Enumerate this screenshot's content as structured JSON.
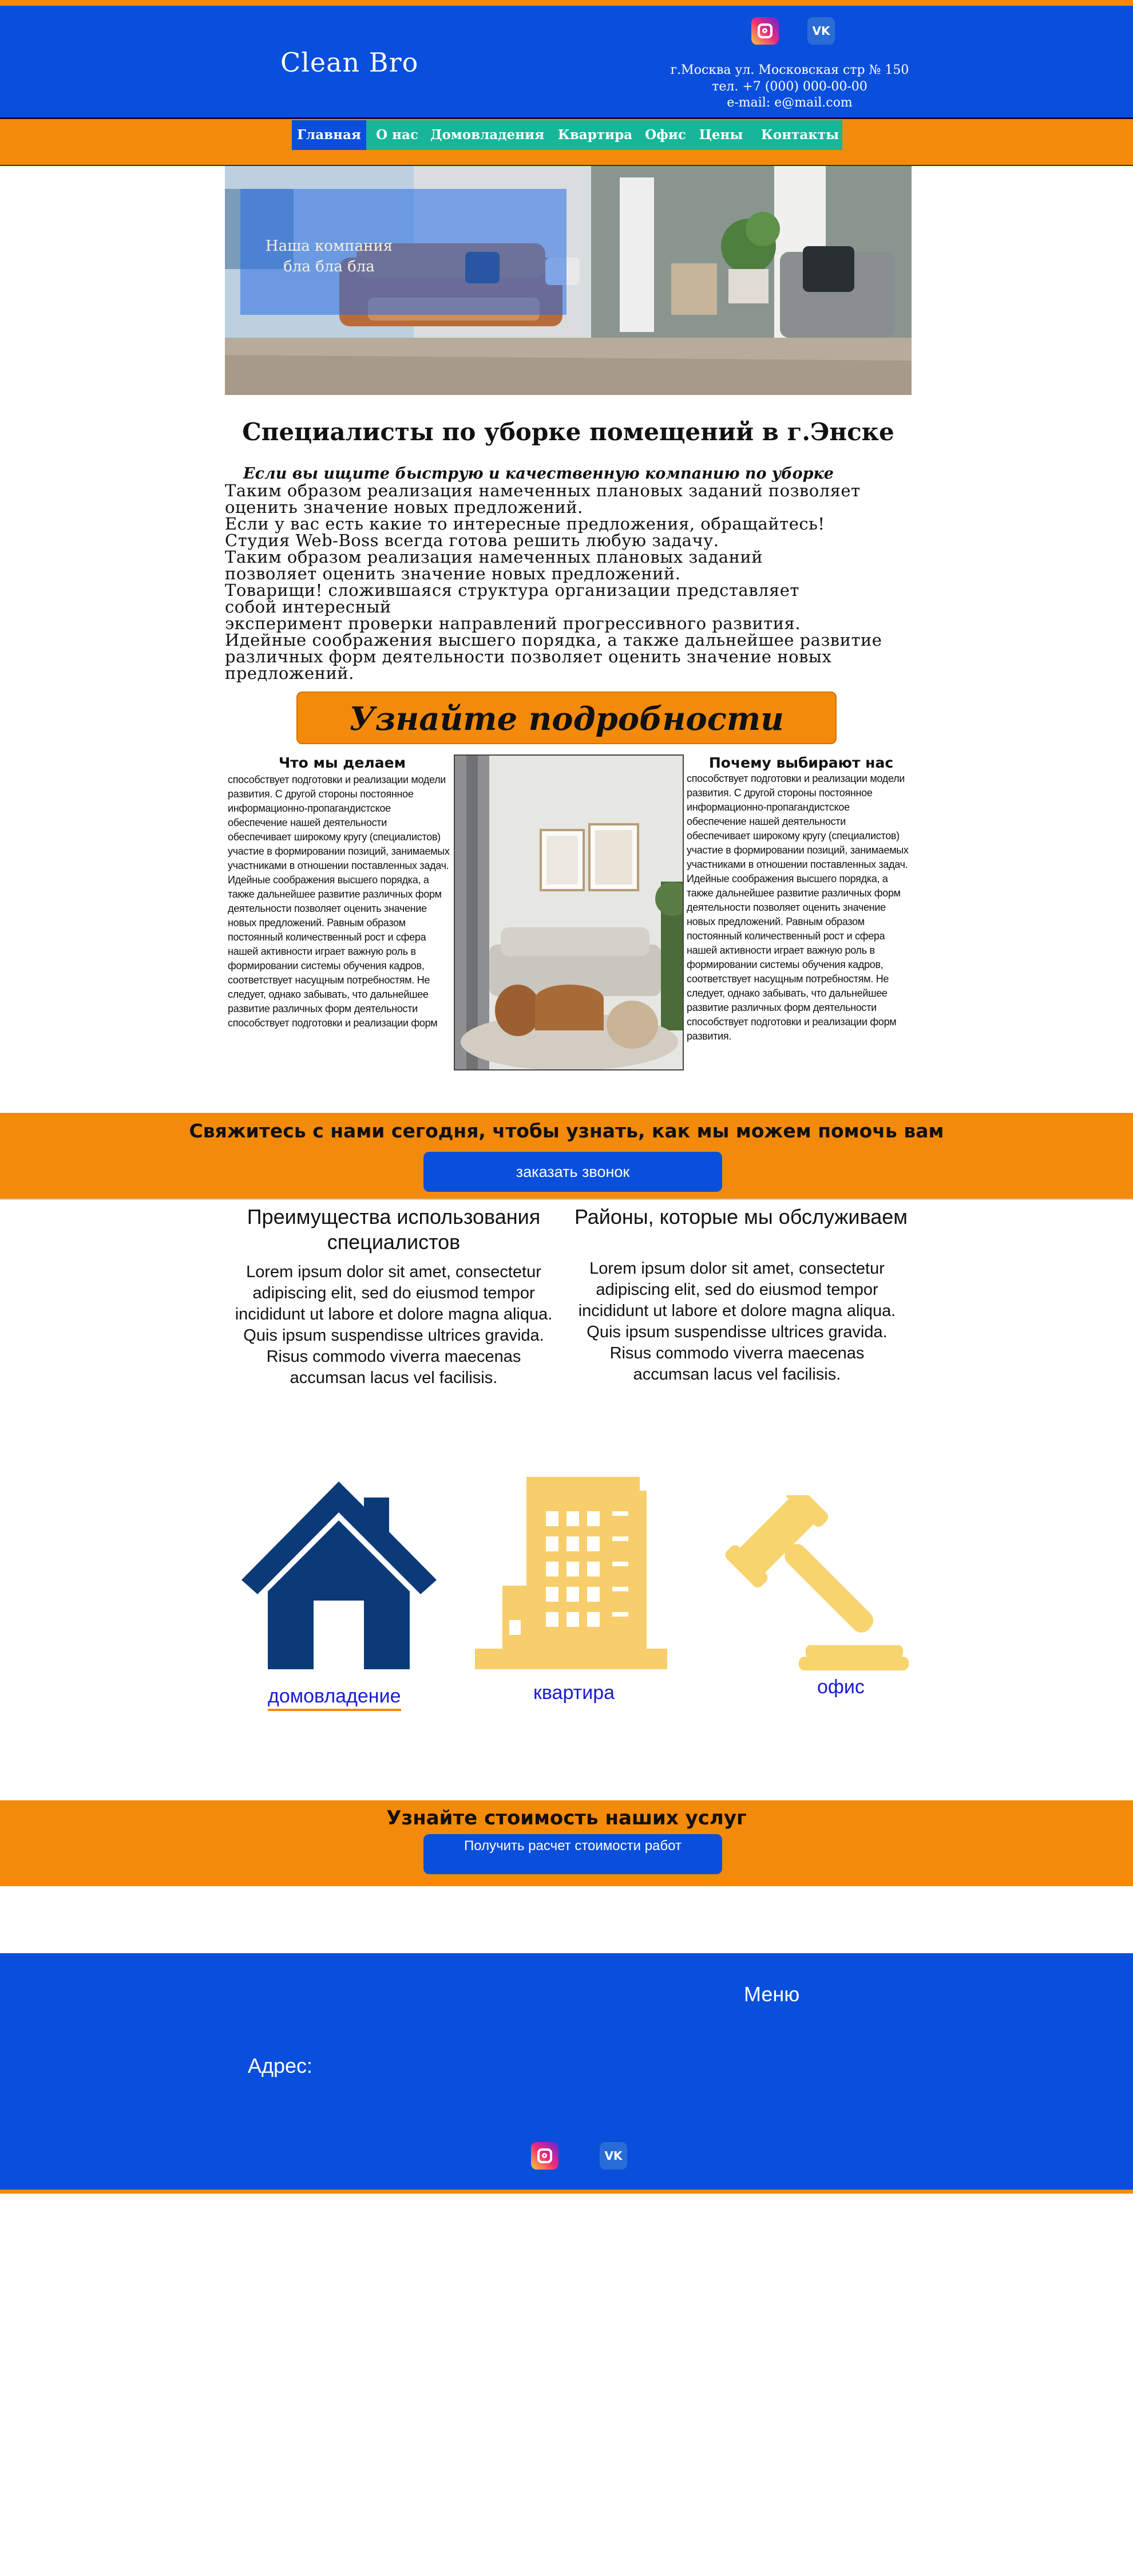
{
  "header": {
    "logo": "Clean Bro",
    "address": "г.Москва ул. Московская стр № 150",
    "phone": "тел. +7 (000) 000-00-00",
    "email": "e-mail: e@mail.com",
    "social": [
      {
        "name": "instagram",
        "icon": "instagram-icon"
      },
      {
        "name": "vk",
        "icon": "vk-icon",
        "glyph": "VK"
      }
    ]
  },
  "nav": {
    "items": [
      "Главная",
      "О нас",
      "Домовладения",
      "Квартира",
      "Офис",
      "Цены",
      "Контакты"
    ],
    "active": "Главная"
  },
  "hero": {
    "line1": "Наша компания",
    "line2": "бла бла бла"
  },
  "intro": {
    "title": "Специалисты по уборке помещений в г.Энске",
    "bold_line": "Если вы ищите быструю и качественную компанию по уборке",
    "lines": [
      "Таким образом реализация намеченных плановых заданий позволяет",
      "оценить значение новых предложений.",
      " Если у вас есть какие то интересные предложения, обращайтесь!",
      "Студия Web-Boss всегда готова решить любую задачу.",
      " Таким образом реализация намеченных плановых заданий",
      " позволяет оценить значение новых предложений.",
      " Товарищи! сложившаяся структура организации представляет",
      "собой интересный",
      "эксперимент проверки направлений прогрессивного развития.",
      " Идейные соображения высшего порядка, а также дальнейшее развитие",
      " различных форм деятельности позволяет оценить значение новых",
      "предложений."
    ]
  },
  "learn_more": "Узнайте подробности",
  "what_we_do": {
    "title": "Что мы делаем",
    "text": " способствует подготовки и реализации модели развития. С другой стороны постоянное информационно-пропагандистское обеспечение нашей деятельности обеспечивает широкому кругу (специалистов) участие в формировании позиций, занимаемых участниками в отношении поставленных задач. Идейные соображения высшего порядка, а также дальнейшее развитие различных форм деятельности позволяет оценить значение новых предложений. Равным образом постоянный количественный рост и сфера нашей активности играет важную роль в формировании системы обучения кадров, соответствует насущным потребностям. Не следует, однако забывать, что дальнейшее развитие различных форм деятельности способствует подготовки и реализации форм"
  },
  "why_us": {
    "title": "Почему выбирают нас",
    "text": " способствует подготовки и реализации модели развития. С другой стороны постоянное информационно-пропагандистское обеспечение нашей деятельности обеспечивает широкому кругу (специалистов) участие в формировании позиций, занимаемых участниками в отношении поставленных задач. Идейные соображения высшего порядка, а также дальнейшее развитие различных форм деятельности позволяет оценить значение новых предложений. Равным образом постоянный количественный рост и сфера нашей активности играет важную роль в формировании системы обучения кадров, соответствует насущным потребностям. Не следует, однако забывать, что дальнейшее развитие различных форм деятельности способствует подготовки и реализации форм развития."
  },
  "cta1": {
    "title": "Свяжитесь с нами сегодня, чтобы узнать, как мы можем помочь вам",
    "button": "заказать звонок"
  },
  "advantages": {
    "title": "Преимущества использования специалистов",
    "text": "Lorem ipsum dolor sit amet, consectetur adipiscing elit, sed do eiusmod tempor incididunt ut labore et dolore magna aliqua. Quis ipsum suspendisse ultrices gravida. Risus commodo viverra maecenas accumsan lacus vel facilisis."
  },
  "areas": {
    "title": "Районы, которые мы обслуживаем",
    "text": "Lorem ipsum dolor sit amet, consectetur adipiscing elit, sed do eiusmod tempor incididunt ut labore et dolore magna aliqua. Quis ipsum suspendisse ultrices gravida. Risus commodo viverra maecenas accumsan lacus vel facilisis."
  },
  "services": [
    {
      "label": "домовладение",
      "icon": "house-icon",
      "color": "#0b3a78"
    },
    {
      "label": "квартира",
      "icon": "apartment-building-icon",
      "color": "#f7ce6b"
    },
    {
      "label": "офис",
      "icon": "gavel-icon",
      "color": "#f7d46e"
    }
  ],
  "cta2": {
    "title": "Узнайте стоимость наших услуг",
    "button": "Получить расчет стоимости работ"
  },
  "footer": {
    "menu": "Меню",
    "address": "Адрес:"
  },
  "colors": {
    "brand_blue": "#0a4fdc",
    "accent_orange": "#f38a0b",
    "nav_teal": "#17b59a"
  }
}
